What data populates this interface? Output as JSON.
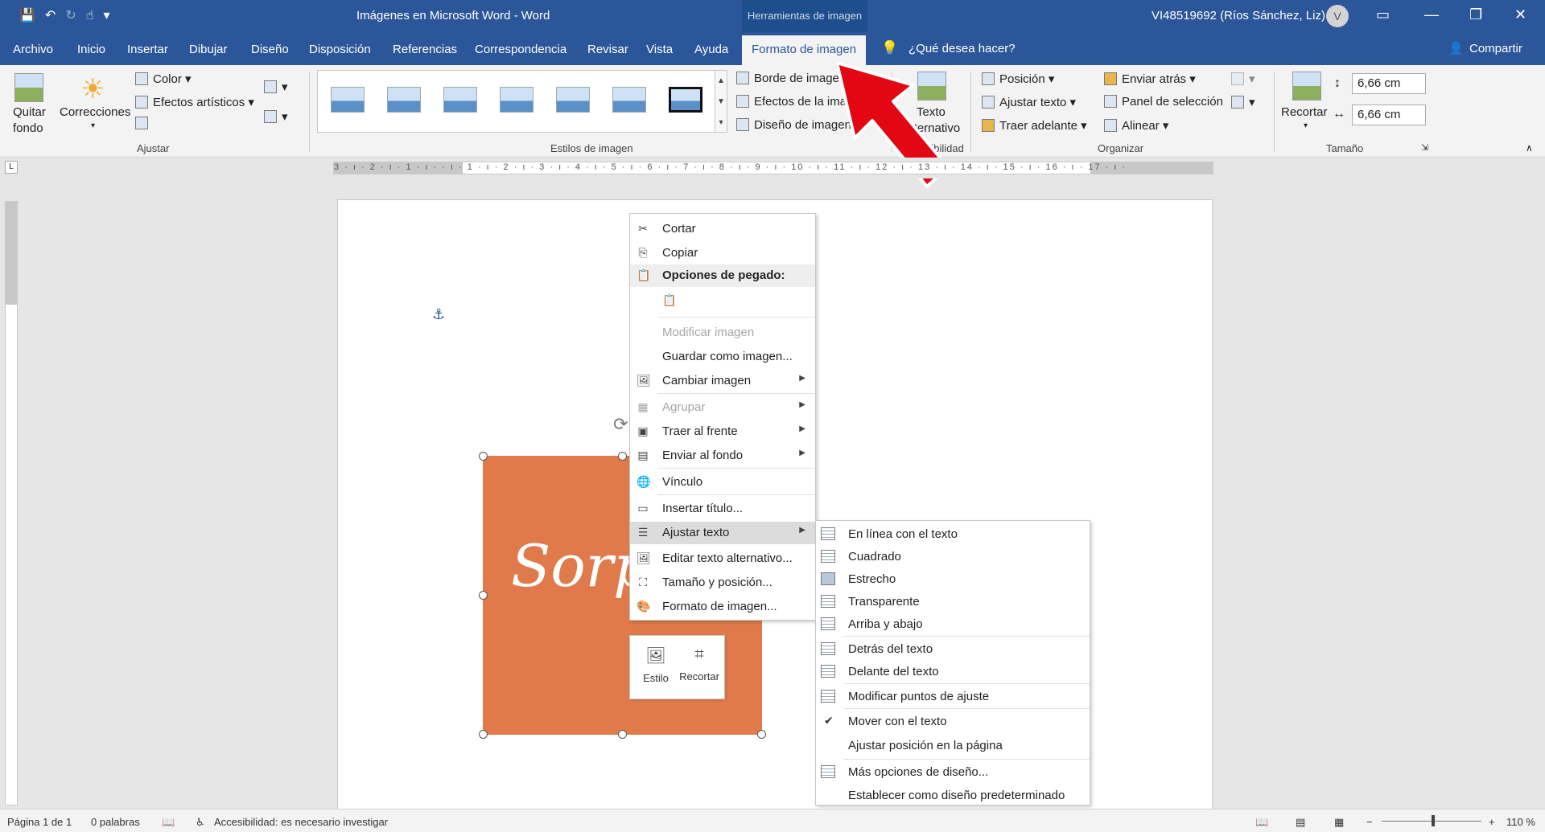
{
  "titlebar": {
    "doc_title": "Imágenes en Microsoft Word  -  Word",
    "tools_tab": "Herramientas de imagen",
    "user": "VI48519692 (Ríos Sánchez, Liz)",
    "avatar_initial": "V"
  },
  "menu": {
    "tabs": [
      "Archivo",
      "Inicio",
      "Insertar",
      "Dibujar",
      "Diseño",
      "Disposición",
      "Referencias",
      "Correspondencia",
      "Revisar",
      "Vista",
      "Ayuda",
      "Formato de imagen"
    ],
    "active_tab": "Formato de imagen",
    "tellme": "¿Qué desea hacer?",
    "share": "Compartir"
  },
  "ribbon": {
    "ajustar": {
      "quitar_fondo_1": "Quitar",
      "quitar_fondo_2": "fondo",
      "correcciones": "Correcciones",
      "color": "Color",
      "efectos": "Efectos artísticos",
      "label": "Ajustar"
    },
    "estilos": {
      "borde": "Borde de imagen",
      "efectos": "Efectos de la imagen",
      "diseno": "Diseño de imagen",
      "label": "Estilos de imagen"
    },
    "accesibilidad": {
      "texto_1": "Texto",
      "texto_2": "alternativo",
      "label": "Accesibilidad"
    },
    "organizar": {
      "posicion": "Posición",
      "ajustar_texto": "Ajustar texto",
      "traer_adelante": "Traer adelante",
      "enviar_atras": "Enviar atrás",
      "panel": "Panel de selección",
      "alinear": "Alinear",
      "label": "Organizar"
    },
    "tamano": {
      "recortar": "Recortar",
      "alto": "6,66 cm",
      "ancho": "6,66 cm",
      "label": "Tamaño"
    }
  },
  "ruler": {
    "text": "3 · ı · 2 · ı · 1 · ı ·   · ı · 1 · ı · 2 · ı · 3 · ı · 4 · ı · 5 · ı · 6 · ı · 7 · ı · 8 · ı · 9 · ı · 10 · ı · 11 · ı · 12 · ı · 13 · ı · 14 · ı · 15 · ı · 16 · ı · 17 · ı ·"
  },
  "image": {
    "text": "Sorpr",
    "mini_estilo": "Estilo",
    "mini_recortar": "Recortar"
  },
  "context_menu": {
    "cortar": "Cortar",
    "copiar": "Copiar",
    "opciones_pegado": "Opciones de pegado:",
    "modificar_imagen": "Modificar imagen",
    "guardar_como": "Guardar como imagen...",
    "cambiar_imagen": "Cambiar imagen",
    "agrupar": "Agrupar",
    "traer_frente": "Traer al frente",
    "enviar_fondo": "Enviar al fondo",
    "vinculo": "Vínculo",
    "insertar_titulo": "Insertar título...",
    "ajustar_texto": "Ajustar texto",
    "editar_alt": "Editar texto alternativo...",
    "tamano_posicion": "Tamaño y posición...",
    "formato_imagen": "Formato de imagen..."
  },
  "submenu": {
    "en_linea": "En línea con el texto",
    "cuadrado": "Cuadrado",
    "estrecho": "Estrecho",
    "transparente": "Transparente",
    "arriba_abajo": "Arriba y abajo",
    "detras": "Detrás del texto",
    "delante": "Delante del texto",
    "modificar_puntos": "Modificar puntos de ajuste",
    "mover_con_texto": "Mover con el texto",
    "ajustar_posicion": "Ajustar posición en la página",
    "mas_opciones": "Más opciones de diseño...",
    "establecer": "Establecer como diseño predeterminado"
  },
  "status": {
    "pagina": "Página 1 de 1",
    "palabras": "0 palabras",
    "accesibilidad": "Accesibilidad: es necesario investigar",
    "zoom": "110 %"
  },
  "colors": {
    "brand_blue": "#2b579a",
    "image_orange": "#e07a4a",
    "arrow_red": "#e30613"
  }
}
